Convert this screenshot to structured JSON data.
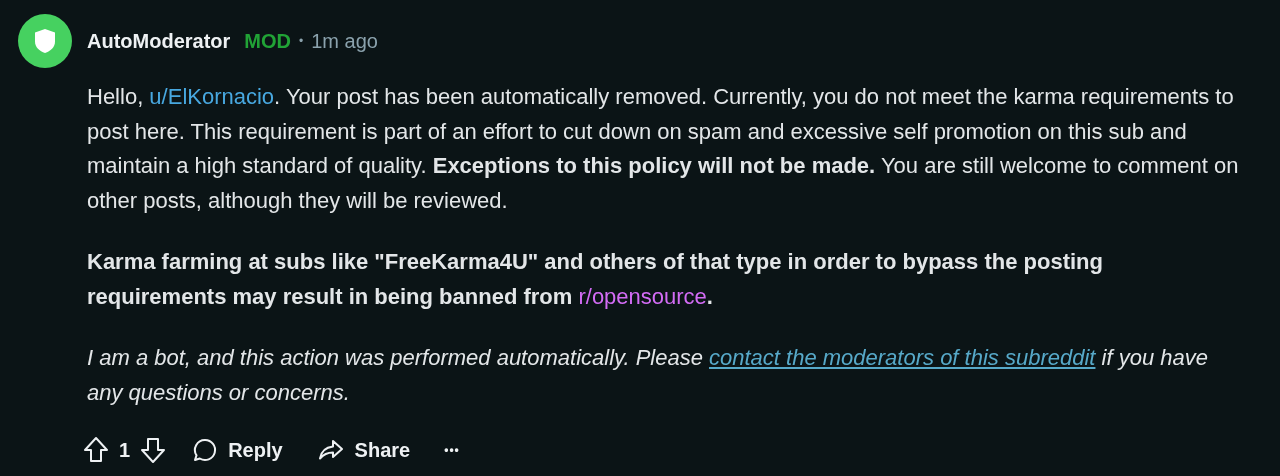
{
  "comment": {
    "author": "AutoModerator",
    "flair": "MOD",
    "separator": "•",
    "time": "1m ago",
    "paragraphs": [
      {
        "kind": "normal",
        "segments": [
          {
            "kind": "text",
            "text": "Hello, "
          },
          {
            "kind": "user",
            "text": "u/ElKornacio"
          },
          {
            "kind": "text",
            "text": ". Your post has been automatically removed. Currently, you do not meet the karma requirements to post here. This requirement is part of an effort to cut down on spam and excessive self promotion on this sub and maintain a high standard of quality. **Exceptions to this policy will not be made.** You are still welcome to comment on other posts, although they will be reviewed."
          }
        ]
      },
      {
        "kind": "bold",
        "segments": [
          {
            "kind": "text",
            "text": "Karma farming at subs like \"FreeKarma4U\" and others of that type in order to bypass the posting requirements may result in being banned from "
          },
          {
            "kind": "subreddit",
            "text": "r/opensource"
          },
          {
            "kind": "text",
            "text": "."
          }
        ]
      },
      {
        "kind": "italic",
        "segments": [
          {
            "kind": "text",
            "text": "I am a bot, and this action was performed automatically. Please "
          },
          {
            "kind": "link",
            "text": "contact the moderators of this subreddit"
          },
          {
            "kind": "text",
            "text": " if you have any questions or concerns."
          }
        ]
      }
    ],
    "votes": "1",
    "actions": [
      {
        "kind": "reply",
        "label": "Reply"
      },
      {
        "kind": "share",
        "label": "Share"
      }
    ],
    "more": "•••"
  }
}
